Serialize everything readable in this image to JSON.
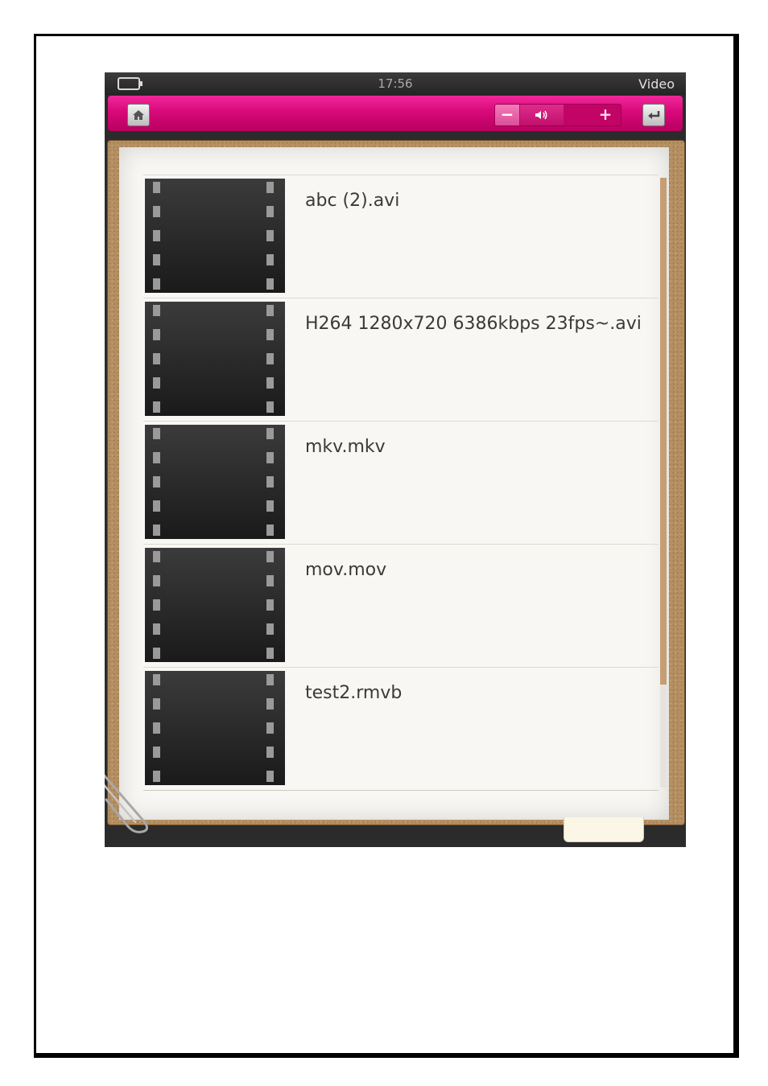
{
  "status_bar": {
    "battery_icon": "battery-icon",
    "time": "17:56",
    "app_title": "Video"
  },
  "toolbar": {
    "home_icon": "home-icon",
    "back_icon": "back-icon",
    "volume": {
      "minus_label": "−",
      "plus_label": "+",
      "speaker_icon": "speaker-icon"
    },
    "accent_color": "#d8097a"
  },
  "file_list": {
    "items": [
      {
        "name": "abc (2).avi",
        "thumbnail_icon": "film-strip-icon"
      },
      {
        "name": "H264 1280x720 6386kbps 23fps~.avi",
        "thumbnail_icon": "film-strip-icon"
      },
      {
        "name": "mkv.mkv",
        "thumbnail_icon": "film-strip-icon"
      },
      {
        "name": "mov.mov",
        "thumbnail_icon": "film-strip-icon"
      },
      {
        "name": "test2.rmvb",
        "thumbnail_icon": "film-strip-icon"
      }
    ]
  },
  "decorations": {
    "paperclip_icon": "paperclip-icon"
  }
}
